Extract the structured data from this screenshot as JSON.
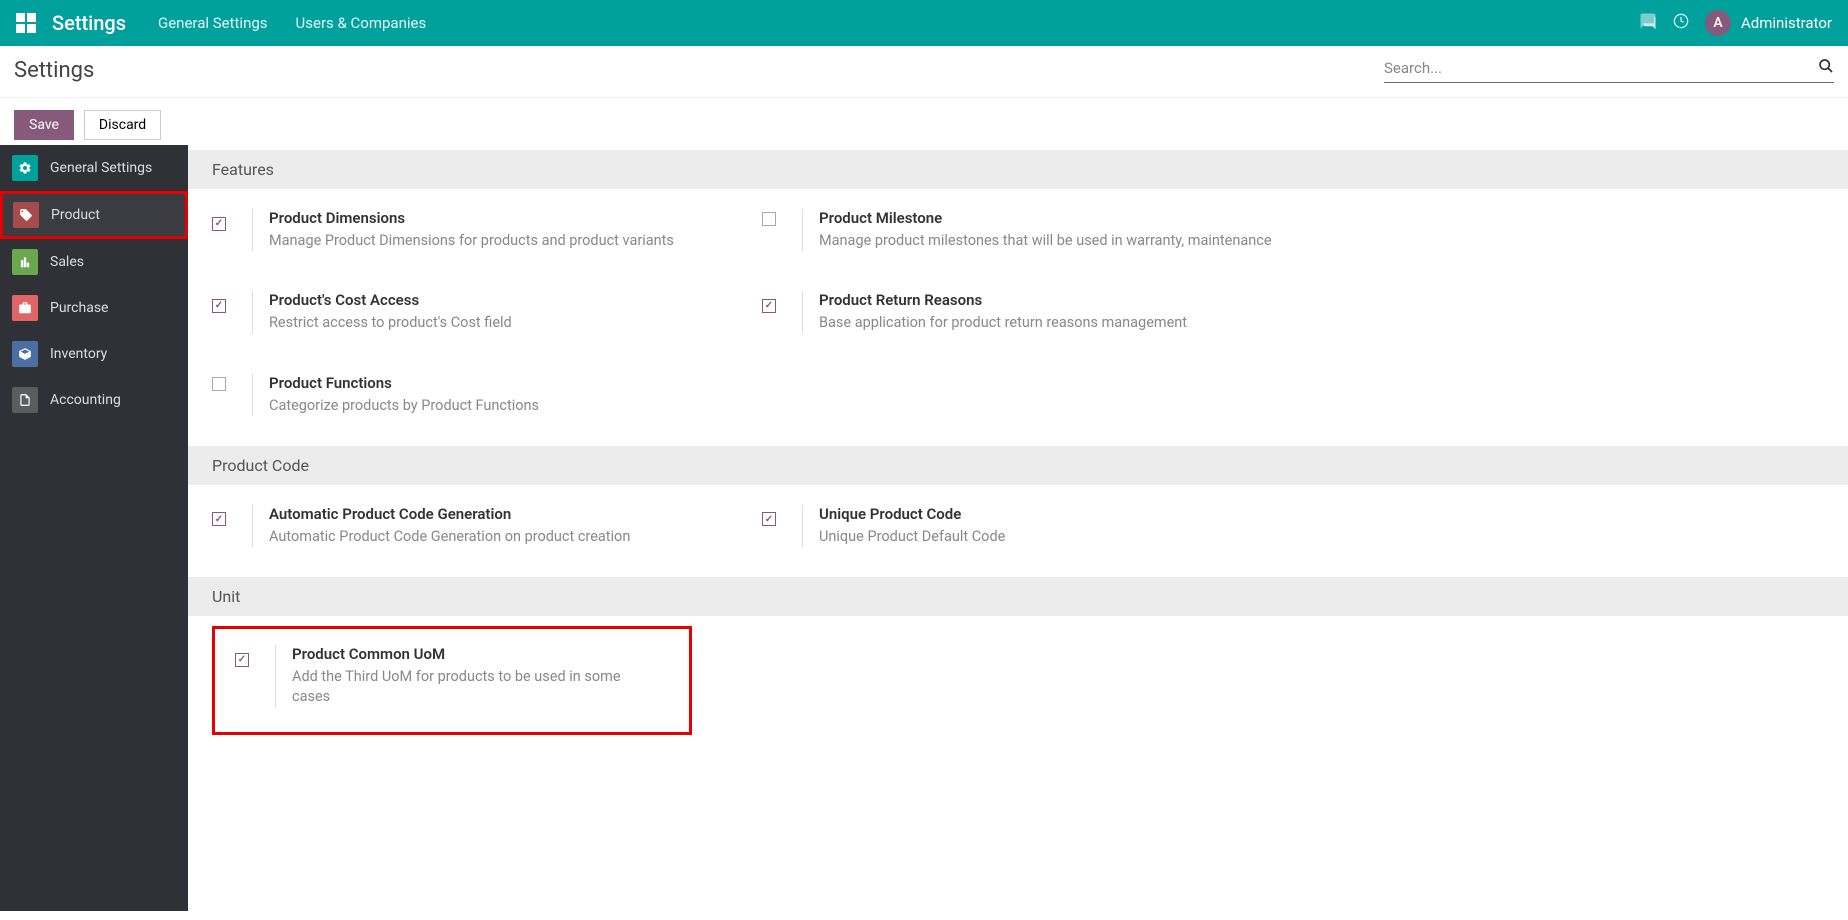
{
  "header": {
    "title": "Settings",
    "nav": [
      "General Settings",
      "Users & Companies"
    ],
    "user_initial": "A",
    "username": "Administrator"
  },
  "sub": {
    "title": "Settings",
    "search_placeholder": "Search..."
  },
  "buttons": {
    "save": "Save",
    "discard": "Discard"
  },
  "sidebar": {
    "items": [
      {
        "label": "General Settings",
        "icon": "general"
      },
      {
        "label": "Product",
        "icon": "product"
      },
      {
        "label": "Sales",
        "icon": "sales"
      },
      {
        "label": "Purchase",
        "icon": "purchase"
      },
      {
        "label": "Inventory",
        "icon": "inventory"
      },
      {
        "label": "Accounting",
        "icon": "accounting"
      }
    ]
  },
  "sections": {
    "features": {
      "header": "Features",
      "items": [
        {
          "title": "Product Dimensions",
          "desc": "Manage Product Dimensions for products and product variants",
          "checked": true
        },
        {
          "title": "Product Milestone",
          "desc": "Manage product milestones that will be used in warranty, maintenance",
          "checked": false
        },
        {
          "title": "Product's Cost Access",
          "desc": "Restrict access to product's Cost field",
          "checked": true
        },
        {
          "title": "Product Return Reasons",
          "desc": "Base application for product return reasons management",
          "checked": true
        },
        {
          "title": "Product Functions",
          "desc": "Categorize products by Product Functions",
          "checked": false
        }
      ]
    },
    "product_code": {
      "header": "Product Code",
      "items": [
        {
          "title": "Automatic Product Code Generation",
          "desc": "Automatic Product Code Generation on product creation",
          "checked": true
        },
        {
          "title": "Unique Product Code",
          "desc": "Unique Product Default Code",
          "checked": true
        }
      ]
    },
    "unit": {
      "header": "Unit",
      "items": [
        {
          "title": "Product Common UoM",
          "desc": "Add the Third UoM for products to be used in some cases",
          "checked": true
        }
      ]
    }
  }
}
